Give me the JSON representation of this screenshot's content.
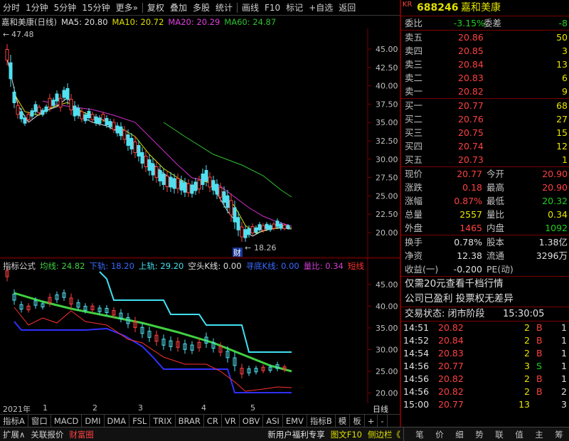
{
  "toolbar": {
    "buttons": [
      "分时",
      "1分钟",
      "5分钟",
      "15分钟",
      "更多»",
      "复权",
      "叠加",
      "多股",
      "统计",
      "画线",
      "F10",
      "标记",
      "+自选",
      "返回"
    ]
  },
  "main_chart": {
    "name": "嘉和美康(日线)",
    "ma5": "MA5: 20.80",
    "ma10": "MA10: 20.72",
    "ma20": "MA20: 20.29",
    "ma60": "MA60: 24.87",
    "high_label": "47.48",
    "low_label": "18.26",
    "cai_label": "财",
    "y_ticks": [
      "45.00",
      "42.50",
      "40.00",
      "37.50",
      "35.00",
      "32.50",
      "30.00",
      "27.50",
      "25.00",
      "22.50",
      "20.00"
    ]
  },
  "sub_chart": {
    "name": "指标公式",
    "jx": "均线: 24.82",
    "xg": "下轨: 18.20",
    "sg": "上轨: 29.20",
    "kt": "空头K线: 0.00",
    "xd": "寻底K线: 0.00",
    "lb": "量比: 0.34",
    "dx": "短线",
    "y_ticks": [
      "45.00",
      "40.00",
      "35.00",
      "30.00",
      "25.00",
      "20.00"
    ]
  },
  "date_axis": {
    "labels": [
      "2021年",
      "1",
      "2",
      "3",
      "4",
      "5"
    ],
    "period": "日线"
  },
  "indicator_tabs": [
    "指标A",
    "窗口",
    "MACD",
    "DMI",
    "DMA",
    "FSL",
    "TRIX",
    "BRAR",
    "CR",
    "VR",
    "OBV",
    "ASI",
    "EMV",
    "指标B",
    "模",
    "板",
    "+",
    "-"
  ],
  "bottom_bar": {
    "left": [
      "扩展∧",
      "关联报价",
      "财富圈"
    ],
    "promo": "新用户福利专享",
    "mid": [
      "图文F10",
      "侧边栏《"
    ],
    "right": [
      "笔",
      "价",
      "细",
      "势",
      "联",
      "值",
      "主",
      "筹"
    ]
  },
  "quote": {
    "market_badge": "KR",
    "code": "688246",
    "name": "嘉和美康",
    "weibi_label": "委比",
    "weibi_value": "-3.15%",
    "weicha_label": "委差",
    "weicha_value": "-8",
    "sells": [
      {
        "label": "卖五",
        "price": "20.86",
        "vol": "50"
      },
      {
        "label": "卖四",
        "price": "20.85",
        "vol": "3"
      },
      {
        "label": "卖三",
        "price": "20.84",
        "vol": "13"
      },
      {
        "label": "卖二",
        "price": "20.83",
        "vol": "6"
      },
      {
        "label": "卖一",
        "price": "20.82",
        "vol": "9"
      }
    ],
    "buys": [
      {
        "label": "买一",
        "price": "20.77",
        "vol": "68"
      },
      {
        "label": "买二",
        "price": "20.76",
        "vol": "27"
      },
      {
        "label": "买三",
        "price": "20.75",
        "vol": "15"
      },
      {
        "label": "买四",
        "price": "20.74",
        "vol": "12"
      },
      {
        "label": "买五",
        "price": "20.73",
        "vol": "1"
      }
    ],
    "stats": [
      {
        "l1": "现价",
        "v1": "20.77",
        "c1": "red",
        "l2": "今开",
        "v2": "20.90",
        "c2": "red"
      },
      {
        "l1": "涨跌",
        "v1": "0.18",
        "c1": "red",
        "l2": "最高",
        "v2": "20.90",
        "c2": "red"
      },
      {
        "l1": "涨幅",
        "v1": "0.87%",
        "c1": "red",
        "l2": "最低",
        "v2": "20.32",
        "c2": "green"
      },
      {
        "l1": "总量",
        "v1": "2557",
        "c1": "yellow",
        "l2": "量比",
        "v2": "0.34",
        "c2": "yellow"
      },
      {
        "l1": "外盘",
        "v1": "1465",
        "c1": "red",
        "l2": "内盘",
        "v2": "1092",
        "c2": "green"
      }
    ],
    "stats2": [
      {
        "l1": "换手",
        "v1": "0.78%",
        "l2": "股本",
        "v2": "1.38亿"
      },
      {
        "l1": "净资",
        "v1": "12.38",
        "l2": "流通",
        "v2": "3296万"
      },
      {
        "l1": "收益(一)",
        "v1": "-0.200",
        "l2": "PE(动)",
        "v2": ""
      }
    ],
    "promo1": "仅需20元查看千档行情",
    "promo2": "公司已盈利 投票权无差异",
    "status_label": "交易状态: 闭市阶段",
    "status_time": "15:30:05",
    "ticks": [
      {
        "t": "14:51",
        "p": "20.82",
        "v": "2",
        "d": "B",
        "n": "1"
      },
      {
        "t": "14:52",
        "p": "20.84",
        "v": "2",
        "d": "B",
        "n": "1"
      },
      {
        "t": "14:54",
        "p": "20.83",
        "v": "2",
        "d": "B",
        "n": "1"
      },
      {
        "t": "14:56",
        "p": "20.77",
        "v": "3",
        "d": "S",
        "n": "1"
      },
      {
        "t": "14:56",
        "p": "20.82",
        "v": "2",
        "d": "B",
        "n": "1"
      },
      {
        "t": "14:56",
        "p": "20.82",
        "v": "2",
        "d": "B",
        "n": "2"
      },
      {
        "t": "15:00",
        "p": "20.77",
        "v": "13",
        "d": "",
        "n": "3"
      }
    ]
  }
}
